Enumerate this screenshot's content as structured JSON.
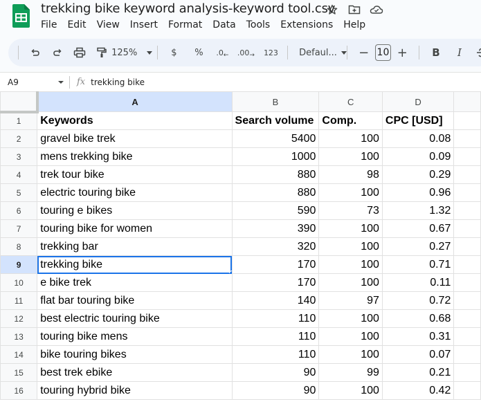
{
  "app": {
    "title": "trekking bike keyword analysis-keyword tool.csv",
    "title_icons": [
      "star-icon",
      "move-to-folder-icon",
      "cloud-saved-icon"
    ],
    "brand_color": "#0f9d58"
  },
  "menu": [
    "File",
    "Edit",
    "View",
    "Insert",
    "Format",
    "Data",
    "Tools",
    "Extensions",
    "Help"
  ],
  "toolbar": {
    "zoom": "125%",
    "currency": "$",
    "percent": "%",
    "decrease_decimal": ".0",
    "increase_decimal": ".00",
    "number_format": "123",
    "font": "Defaul...",
    "font_size": "10",
    "decrease_size": "−",
    "increase_size": "+",
    "bold": "B",
    "italic": "I"
  },
  "formula_bar": {
    "cell_ref": "A9",
    "fx": "fx",
    "value": "trekking bike"
  },
  "sheet": {
    "columns": [
      "A",
      "B",
      "C",
      "D"
    ],
    "selected_column": "A",
    "selected_row": 9,
    "header_row": [
      "Keywords",
      "Search volume",
      "Comp.",
      "CPC [USD]"
    ],
    "rows": [
      [
        "gravel bike trek",
        "5400",
        "100",
        "0.08"
      ],
      [
        "mens trekking bike",
        "1000",
        "100",
        "0.09"
      ],
      [
        "trek tour bike",
        "880",
        "98",
        "0.29"
      ],
      [
        "electric touring bike",
        "880",
        "100",
        "0.96"
      ],
      [
        "touring e bikes",
        "590",
        "73",
        "1.32"
      ],
      [
        "touring bike for women",
        "390",
        "100",
        "0.67"
      ],
      [
        "trekking bar",
        "320",
        "100",
        "0.27"
      ],
      [
        "trekking bike",
        "170",
        "100",
        "0.71"
      ],
      [
        "e bike trek",
        "170",
        "100",
        "0.11"
      ],
      [
        "flat bar touring bike",
        "140",
        "97",
        "0.72"
      ],
      [
        "best electric touring bike",
        "110",
        "100",
        "0.68"
      ],
      [
        "touring bike mens",
        "110",
        "100",
        "0.31"
      ],
      [
        "bike touring bikes",
        "110",
        "100",
        "0.07"
      ],
      [
        "best trek ebike",
        "90",
        "99",
        "0.21"
      ],
      [
        "touring hybrid bike",
        "90",
        "100",
        "0.42"
      ]
    ]
  }
}
